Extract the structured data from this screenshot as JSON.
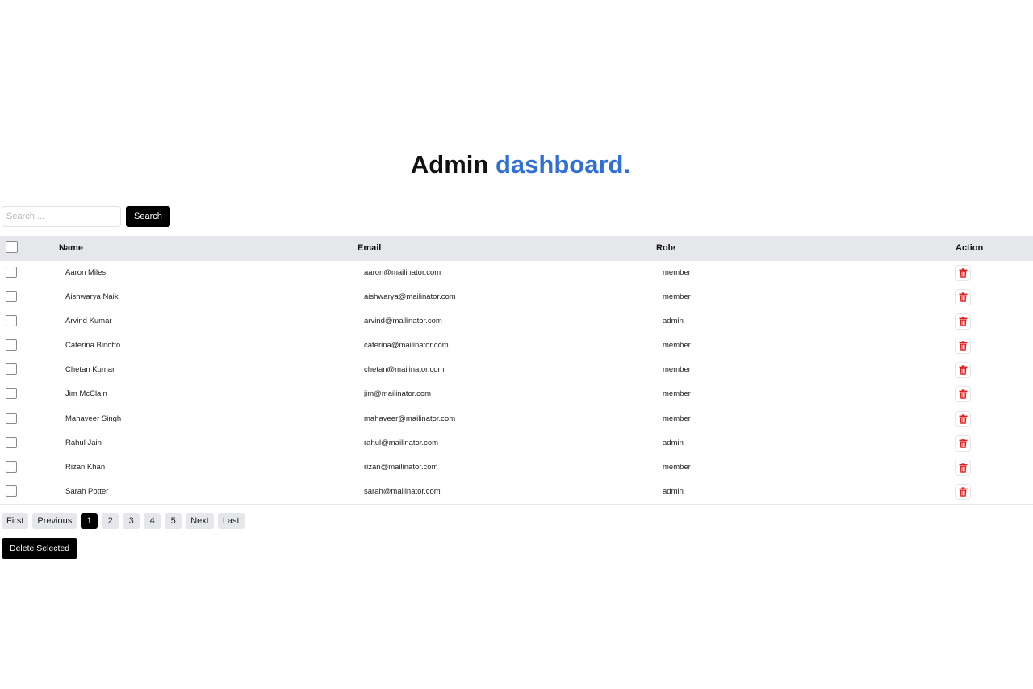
{
  "header": {
    "title_plain": "Admin",
    "title_accent": "dashboard.",
    "accent_color": "#2f6fd6"
  },
  "search": {
    "placeholder": "Search....",
    "value": "",
    "button_label": "Search"
  },
  "table": {
    "columns": [
      "Name",
      "Email",
      "Role",
      "Action"
    ],
    "rows": [
      {
        "name": "Aaron Miles",
        "email": "aaron@mailinator.com",
        "role": "member"
      },
      {
        "name": "Aishwarya Naik",
        "email": "aishwarya@mailinator.com",
        "role": "member"
      },
      {
        "name": "Arvind Kumar",
        "email": "arvind@mailinator.com",
        "role": "admin"
      },
      {
        "name": "Caterina Binotto",
        "email": "caterina@mailinator.com",
        "role": "member"
      },
      {
        "name": "Chetan Kumar",
        "email": "chetan@mailinator.com",
        "role": "member"
      },
      {
        "name": "Jim McClain",
        "email": "jim@mailinator.com",
        "role": "member"
      },
      {
        "name": "Mahaveer Singh",
        "email": "mahaveer@mailinator.com",
        "role": "member"
      },
      {
        "name": "Rahul Jain",
        "email": "rahul@mailinator.com",
        "role": "admin"
      },
      {
        "name": "Rizan Khan",
        "email": "rizan@mailinator.com",
        "role": "member"
      },
      {
        "name": "Sarah Potter",
        "email": "sarah@mailinator.com",
        "role": "admin"
      }
    ],
    "action_icon": "trash-icon",
    "delete_color": "#e01e1e"
  },
  "pagination": {
    "first": "First",
    "previous": "Previous",
    "pages": [
      "1",
      "2",
      "3",
      "4",
      "5"
    ],
    "current_page": "1",
    "next": "Next",
    "last": "Last"
  },
  "footer": {
    "delete_selected_label": "Delete Selected"
  }
}
